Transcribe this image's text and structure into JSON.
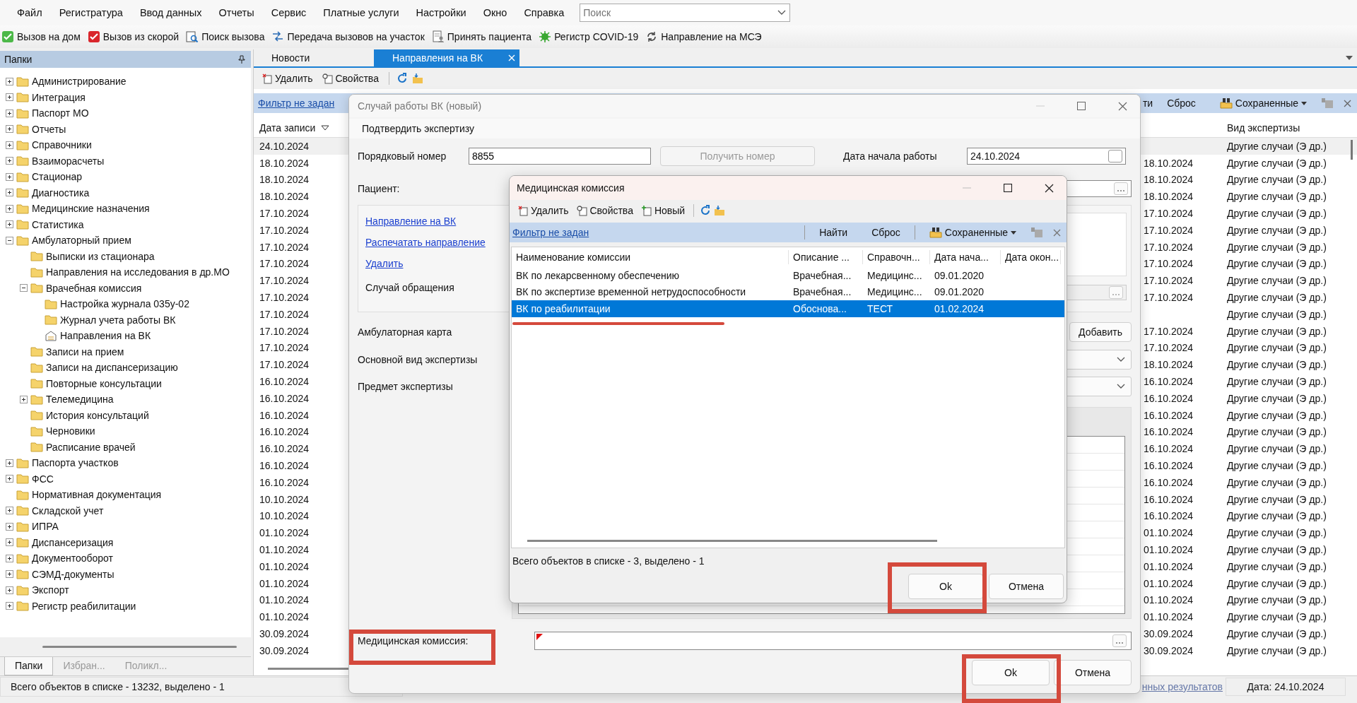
{
  "menu": [
    "Файл",
    "Регистратура",
    "Ввод данных",
    "Отчеты",
    "Сервис",
    "Платные услуги",
    "Настройки",
    "Окно",
    "Справка"
  ],
  "search": {
    "placeholder": "Поиск"
  },
  "toolbar": [
    {
      "label": "Вызов на дом",
      "kind": "home"
    },
    {
      "label": "Вызов из скорой",
      "kind": "ambulance"
    },
    {
      "label": "Поиск вызова",
      "kind": "search"
    },
    {
      "label": "Передача вызовов на участок",
      "kind": "transfer"
    },
    {
      "label": "Принять пациента",
      "kind": "accept"
    },
    {
      "label": "Регистр COVID-19",
      "kind": "virus"
    },
    {
      "label": "Направление на МСЭ",
      "kind": "referral"
    }
  ],
  "sidebar": {
    "title": "Папки",
    "tree": [
      {
        "label": "Администрирование",
        "kind": "folder",
        "expanded": false
      },
      {
        "label": "Интеграция",
        "kind": "folder",
        "expanded": false
      },
      {
        "label": "Паспорт МО",
        "kind": "folder",
        "expanded": false
      },
      {
        "label": "Отчеты",
        "kind": "folder",
        "expanded": false
      },
      {
        "label": "Справочники",
        "kind": "folder",
        "expanded": false
      },
      {
        "label": "Взаиморасчеты",
        "kind": "folder",
        "expanded": false
      },
      {
        "label": "Стационар",
        "kind": "folder",
        "expanded": false
      },
      {
        "label": "Диагностика",
        "kind": "folder",
        "expanded": false
      },
      {
        "label": "Медицинские назначения",
        "kind": "folder",
        "expanded": false
      },
      {
        "label": "Статистика",
        "kind": "folder",
        "expanded": false
      },
      {
        "label": "Амбулаторный прием",
        "kind": "folder",
        "expanded": true,
        "children": [
          {
            "label": "Выписки из стационара",
            "kind": "folder"
          },
          {
            "label": "Направления на исследования в др.МО",
            "kind": "folder"
          },
          {
            "label": "Врачебная комиссия",
            "kind": "folder",
            "expanded": true,
            "children": [
              {
                "label": "Настройка журнала 035у-02",
                "kind": "folder"
              },
              {
                "label": "Журнал учета работы ВК",
                "kind": "folder"
              },
              {
                "label": "Направления на ВК",
                "kind": "form"
              }
            ]
          },
          {
            "label": "Записи на прием",
            "kind": "folder"
          },
          {
            "label": "Записи на диспансеризацию",
            "kind": "folder"
          },
          {
            "label": "Повторные консультации",
            "kind": "folder"
          },
          {
            "label": "Телемедицина",
            "kind": "folder",
            "expanded": false
          },
          {
            "label": "История консультаций",
            "kind": "folder"
          },
          {
            "label": "Черновики",
            "kind": "folder"
          },
          {
            "label": "Расписание врачей",
            "kind": "folder"
          }
        ]
      },
      {
        "label": "Паспорта участков",
        "kind": "folder",
        "expanded": false
      },
      {
        "label": "ФСС",
        "kind": "folder",
        "expanded": false
      },
      {
        "label": "Нормативная документация",
        "kind": "folder"
      },
      {
        "label": "Складской учет",
        "kind": "folder",
        "expanded": false
      },
      {
        "label": "ИПРА",
        "kind": "folder",
        "expanded": false
      },
      {
        "label": "Диспансеризация",
        "kind": "folder",
        "expanded": false
      },
      {
        "label": "Документооборот",
        "kind": "folder",
        "expanded": false
      },
      {
        "label": "СЭМД-документы",
        "kind": "folder",
        "expanded": false
      },
      {
        "label": "Экспорт",
        "kind": "folder",
        "expanded": false
      },
      {
        "label": "Регистр реабилитации",
        "kind": "folder",
        "expanded": false
      }
    ],
    "tabs": [
      {
        "label": "Папки",
        "selected": true
      },
      {
        "label": "Избран...",
        "selected": false
      },
      {
        "label": "Поликл...",
        "selected": false
      }
    ]
  },
  "tabs": [
    {
      "label": "Новости",
      "selected": false,
      "closable": false
    },
    {
      "label": "Направления на ВК",
      "selected": true,
      "closable": true
    }
  ],
  "list_toolbar": [
    {
      "label": "Удалить",
      "kind": "delete"
    },
    {
      "label": "Свойства",
      "kind": "properties"
    }
  ],
  "filter_bar": {
    "filter_link": "Фильтр не задан",
    "find": "ти",
    "reset": "Сброс",
    "saved": "Сохраненные"
  },
  "grid": {
    "columns": [
      "Дата записи",
      "Вид экспертизы"
    ],
    "rows": [
      {
        "date": "24.10.2024",
        "expertise_type": "Другие случаи (Э др.)"
      },
      {
        "date": "18.10.2024",
        "column_2": "18.10.2024",
        "expertise_type": "Другие случаи (Э др.)"
      },
      {
        "date": "18.10.2024",
        "column_2": "18.10.2024",
        "expertise_type": "Другие случаи (Э др.)"
      },
      {
        "date": "18.10.2024",
        "column_2": "18.10.2024",
        "expertise_type": "Другие случаи (Э др.)"
      },
      {
        "date": "17.10.2024",
        "column_2": "17.10.2024",
        "expertise_type": "Другие случаи (Э др.)"
      },
      {
        "date": "17.10.2024",
        "column_2": "17.10.2024",
        "expertise_type": "Другие случаи (Э др.)"
      },
      {
        "date": "17.10.2024",
        "column_2": "17.10.2024",
        "expertise_type": "Другие случаи (Э др.)"
      },
      {
        "date": "17.10.2024",
        "column_2": "17.10.2024",
        "expertise_type": "Другие случаи (Э др.)"
      },
      {
        "date": "17.10.2024",
        "column_2": "17.10.2024",
        "expertise_type": "Другие случаи (Э др.)"
      },
      {
        "date": "17.10.2024",
        "column_2": "17.10.2024",
        "expertise_type": "Другие случаи (Э др.)"
      },
      {
        "date": "17.10.2024",
        "expertise_type": "Другие случаи (Э др.)"
      },
      {
        "date": "17.10.2024",
        "column_2": "17.10.2024",
        "expertise_type": "Другие случаи (Э др.)"
      },
      {
        "date": "17.10.2024",
        "column_2": "17.10.2024",
        "expertise_type": "Другие случаи (Э др.)"
      },
      {
        "date": "17.10.2024",
        "column_2": "18.10.2024",
        "expertise_type": "Другие случаи (Э др.)"
      },
      {
        "date": "16.10.2024",
        "column_2": "16.10.2024",
        "expertise_type": "Другие случаи (Э др.)"
      },
      {
        "date": "16.10.2024",
        "column_2": "16.10.2024",
        "expertise_type": "Другие случаи (Э др.)"
      },
      {
        "date": "16.10.2024",
        "column_2": "16.10.2024",
        "expertise_type": "Другие случаи (Э др.)"
      },
      {
        "date": "16.10.2024",
        "column_2": "16.10.2024",
        "expertise_type": "Другие случаи (Э др.)"
      },
      {
        "date": "16.10.2024",
        "column_2": "16.10.2024",
        "expertise_type": "Другие случаи (Э др.)"
      },
      {
        "date": "16.10.2024",
        "column_2": "16.10.2024",
        "expertise_type": "Другие случаи (Э др.)"
      },
      {
        "date": "16.10.2024",
        "column_2": "16.10.2024",
        "expertise_type": "Другие случаи (Э др.)"
      },
      {
        "date": "10.10.2024",
        "column_2": "16.10.2024",
        "expertise_type": "Другие случаи (Э др.)"
      },
      {
        "date": "10.10.2024",
        "column_2": "16.10.2024",
        "expertise_type": "Другие случаи (Э др.)"
      },
      {
        "date": "01.10.2024",
        "column_2": "01.10.2024",
        "expertise_type": "Другие случаи (Э др.)"
      },
      {
        "date": "01.10.2024",
        "column_2": "01.10.2024",
        "expertise_type": "Другие случаи (Э др.)"
      },
      {
        "date": "01.10.2024",
        "column_2": "01.10.2024",
        "expertise_type": "Другие случаи (Э др.)"
      },
      {
        "date": "01.10.2024",
        "column_2": "01.10.2024",
        "expertise_type": "Другие случаи (Э др.)"
      },
      {
        "date": "01.10.2024",
        "column_2": "01.10.2024",
        "expertise_type": "Другие случаи (Э др.)"
      },
      {
        "date": "01.10.2024",
        "column_2": "01.10.2024",
        "expertise_type": "Другие случаи (Э др.)"
      },
      {
        "date": "30.09.2024",
        "column_2": "30.09.2024",
        "expertise_type": "Другие случаи (Э др.)"
      },
      {
        "date": "30.09.2024",
        "column_2": "30.09.2024",
        "expertise_type": "Другие случаи (Э др.)"
      }
    ]
  },
  "status_bar": {
    "count": "Всего объектов в списке - 13232, выделено - 1",
    "link": "нных результатов",
    "date": "Дата: 24.10.2024"
  },
  "case_dialog": {
    "title": "Случай работы ВК (новый)",
    "menu_item": "Подтвердить экспертизу",
    "number_label": "Порядковый номер",
    "number_value": "8855",
    "get_number_button": {
      "label": "Получить номер",
      "disabled": true
    },
    "start_date_label": "Дата начала работы",
    "start_date_value": "24.10.2024",
    "patient_label": "Пациент:",
    "links": [
      "Направление на ВК",
      "Распечатать направление",
      "Удалить"
    ],
    "appeal_label": "Случай обращения",
    "card_label": "Амбулаторная карта",
    "add_button": "Добавить",
    "expertise_kind_label": "Основной вид экспертизы",
    "expertise_subject_label": "Предмет экспертизы",
    "commission_label": "Медицинская комиссия:",
    "commission_required": true,
    "ok_button": "Ok",
    "cancel_button": "Отмена"
  },
  "commission_dialog": {
    "title": "Медицинская комиссия",
    "toolbar": [
      {
        "label": "Удалить",
        "kind": "delete"
      },
      {
        "label": "Свойства",
        "kind": "properties"
      },
      {
        "label": "Новый",
        "kind": "new"
      }
    ],
    "filter_bar": {
      "filter_link": "Фильтр не задан",
      "find": "Найти",
      "reset": "Сброс",
      "saved": "Сохраненные"
    },
    "columns": [
      "Наименование комиссии",
      "Описание ...",
      "Справочн...",
      "Дата нача...",
      "Дата окон..."
    ],
    "rows": [
      {
        "cells": [
          "ВК по лекарсвенному обеспечению",
          "Врачебная...",
          "Медицинс...",
          "09.01.2020"
        ],
        "selected": false
      },
      {
        "cells": [
          "ВК по экспертизе временной нетрудоспособности",
          "Врачебная...",
          "Медицинс...",
          "09.01.2020"
        ],
        "selected": false
      },
      {
        "cells": [
          "ВК по реабилитации",
          "Обоснова...",
          "ТЕСТ",
          "01.02.2024"
        ],
        "selected": true
      }
    ],
    "status": "Всего объектов в списке - 3, выделено - 1",
    "ok_button": "Ok",
    "cancel_button": "Отмена"
  }
}
